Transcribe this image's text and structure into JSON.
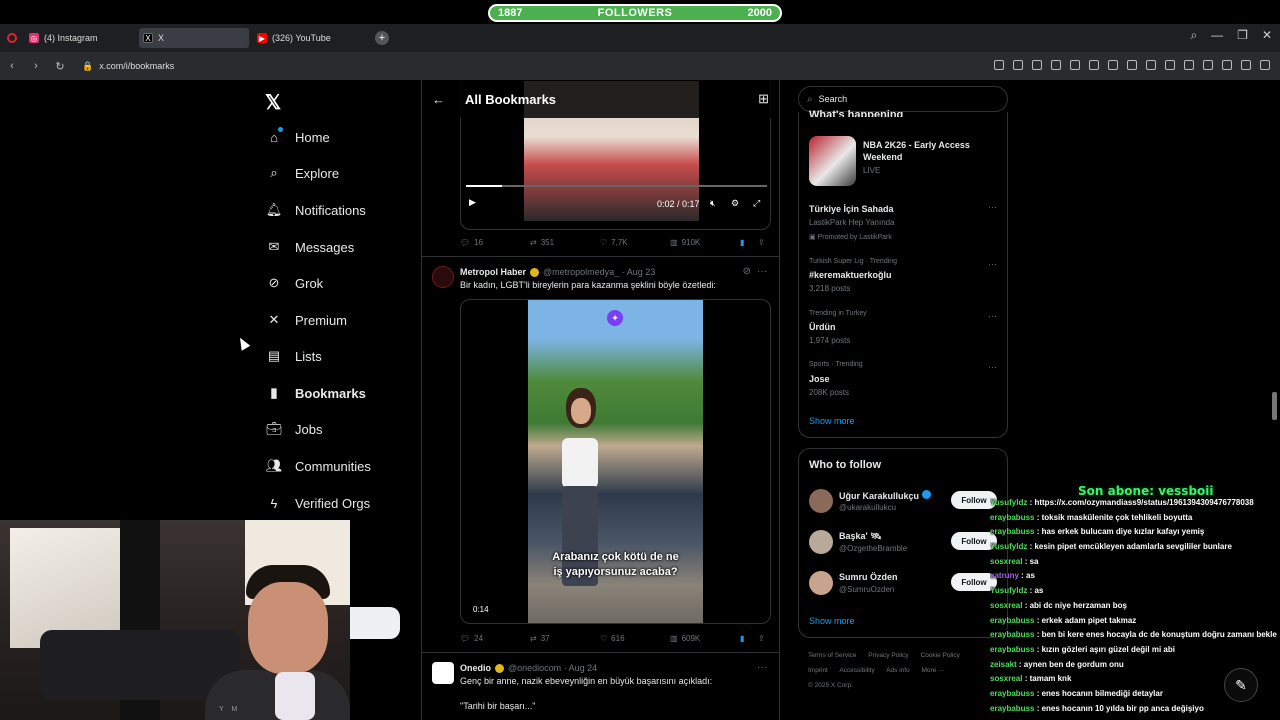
{
  "overlay": {
    "followers_current": "1887",
    "followers_label": "FOLLOWERS",
    "followers_goal": "2000",
    "last_sub": "Son abone: vessboii"
  },
  "browser": {
    "tabs": [
      {
        "label": "(4) Instagram",
        "icon": "instagram-icon",
        "color": "#e1306c"
      },
      {
        "label": "X",
        "icon": "x-icon",
        "color": "#000000"
      },
      {
        "label": "(326) YouTube",
        "icon": "youtube-icon",
        "color": "#ff0000"
      }
    ],
    "url": "x.com/i/bookmarks"
  },
  "sidebar": {
    "items": [
      {
        "label": "Home",
        "icon": "home-icon"
      },
      {
        "label": "Explore",
        "icon": "search-icon"
      },
      {
        "label": "Notifications",
        "icon": "bell-icon"
      },
      {
        "label": "Messages",
        "icon": "envelope-icon"
      },
      {
        "label": "Grok",
        "icon": "grok-icon"
      },
      {
        "label": "Premium",
        "icon": "x-icon"
      },
      {
        "label": "Lists",
        "icon": "list-icon"
      },
      {
        "label": "Bookmarks",
        "icon": "bookmark-icon"
      },
      {
        "label": "Jobs",
        "icon": "briefcase-icon"
      },
      {
        "label": "Communities",
        "icon": "people-icon"
      },
      {
        "label": "Verified Orgs",
        "icon": "lightning-icon"
      }
    ]
  },
  "timeline": {
    "title": "All Bookmarks",
    "tweet1": {
      "time": "0:02 / 0:17",
      "replies": "16",
      "reposts": "351",
      "likes": "7,7K",
      "views": "910K"
    },
    "tweet2": {
      "name": "Metropol Haber",
      "handle": "@metropolmedya_ · Aug 23",
      "text": "Bir kadın, LGBT'li bireylerin para kazanma şeklini böyle özetledi:",
      "subtitle_line1": "Arabanız çok kötü de ne",
      "subtitle_line2": "iş yapıyorsunuz acaba?",
      "duration": "0:14",
      "replies": "24",
      "reposts": "37",
      "likes": "616",
      "views": "609K"
    },
    "tweet3": {
      "name": "Onedio",
      "handle": "@onediocom · Aug 24",
      "text": "Genç bir anne, nazik ebeveynliğin en büyük başarısını açıkladı:",
      "quote": "\"Tarihi bir başarı...\""
    }
  },
  "right": {
    "search_placeholder": "Search",
    "whats_happening": "What's happening",
    "trends": [
      {
        "title": "NBA 2K26 - Early Access Weekend",
        "sub": "LIVE"
      },
      {
        "context": "",
        "title": "Türkiye İçin Sahada",
        "sub": "LastikPark Hep Yanında",
        "promo": "Promoted by LastikPark"
      },
      {
        "context": "Turkish Super Lig · Trending",
        "title": "#keremaktuerkoğlu",
        "sub": "3,218 posts"
      },
      {
        "context": "Trending in Turkey",
        "title": "Ürdün",
        "sub": "1,974 posts"
      },
      {
        "context": "Sports · Trending",
        "title": "Jose",
        "sub": "208K posts"
      }
    ],
    "show_more": "Show more",
    "who_to_follow": "Who to follow",
    "follows": [
      {
        "name": "Uğur Karakullukçu",
        "handle": "@ukarakullukcu",
        "button": "Follow"
      },
      {
        "name": "Başka' 🛰",
        "handle": "@OzgetheBramble",
        "button": "Follow"
      },
      {
        "name": "Sumru Özden",
        "handle": "@SumruOzden",
        "button": "Follow"
      }
    ],
    "show_more_2": "Show more",
    "footer": [
      "Terms of Service",
      "Privacy Policy",
      "Cookie Policy",
      "Imprint",
      "Accessibility",
      "Ads info",
      "More ···",
      "© 2025 X Corp."
    ]
  },
  "chat": [
    {
      "user": "Yusufyldz",
      "msg": ": https://x.com/ozymandiass9/status/1961394309476778038",
      "purple": false
    },
    {
      "user": "eraybabuss",
      "msg": ": toksik maskülenite çok tehlikeli boyutta",
      "purple": false
    },
    {
      "user": "eraybabuss",
      "msg": ": has erkek bulucam diye kızlar kafayı yemiş",
      "purple": false
    },
    {
      "user": "Yusufyldz",
      "msg": ": kesin pipet emcükleyen adamlarla sevgililer bunlare",
      "purple": false
    },
    {
      "user": "sosxreal",
      "msg": ": sa",
      "purple": false
    },
    {
      "user": "xatruny",
      "msg": ": as",
      "purple": true
    },
    {
      "user": "Yusufyldz",
      "msg": ": as",
      "purple": false
    },
    {
      "user": "sosxreal",
      "msg": ": abi dc niye herzaman boş",
      "purple": false
    },
    {
      "user": "eraybabuss",
      "msg": ": erkek adam pipet takmaz",
      "purple": false
    },
    {
      "user": "eraybabuss",
      "msg": ": ben bi kere enes hocayla dc de konuştum doğru zamanı bekle",
      "purple": false
    },
    {
      "user": "eraybabuss",
      "msg": ": kızın gözleri aşırı güzel değil mi abi",
      "purple": false
    },
    {
      "user": "zeisakt",
      "msg": ": aynen ben de gordum onu",
      "purple": false
    },
    {
      "user": "sosxreal",
      "msg": ": tamam knk",
      "purple": false
    },
    {
      "user": "eraybabuss",
      "msg": ": enes hocanın bilmediği detaylar",
      "purple": false
    },
    {
      "user": "eraybabuss",
      "msg": ": enes hocanın 10 yılda bir pp anca değişiyo",
      "purple": false
    }
  ],
  "webcam_shirt_text": "Y M"
}
